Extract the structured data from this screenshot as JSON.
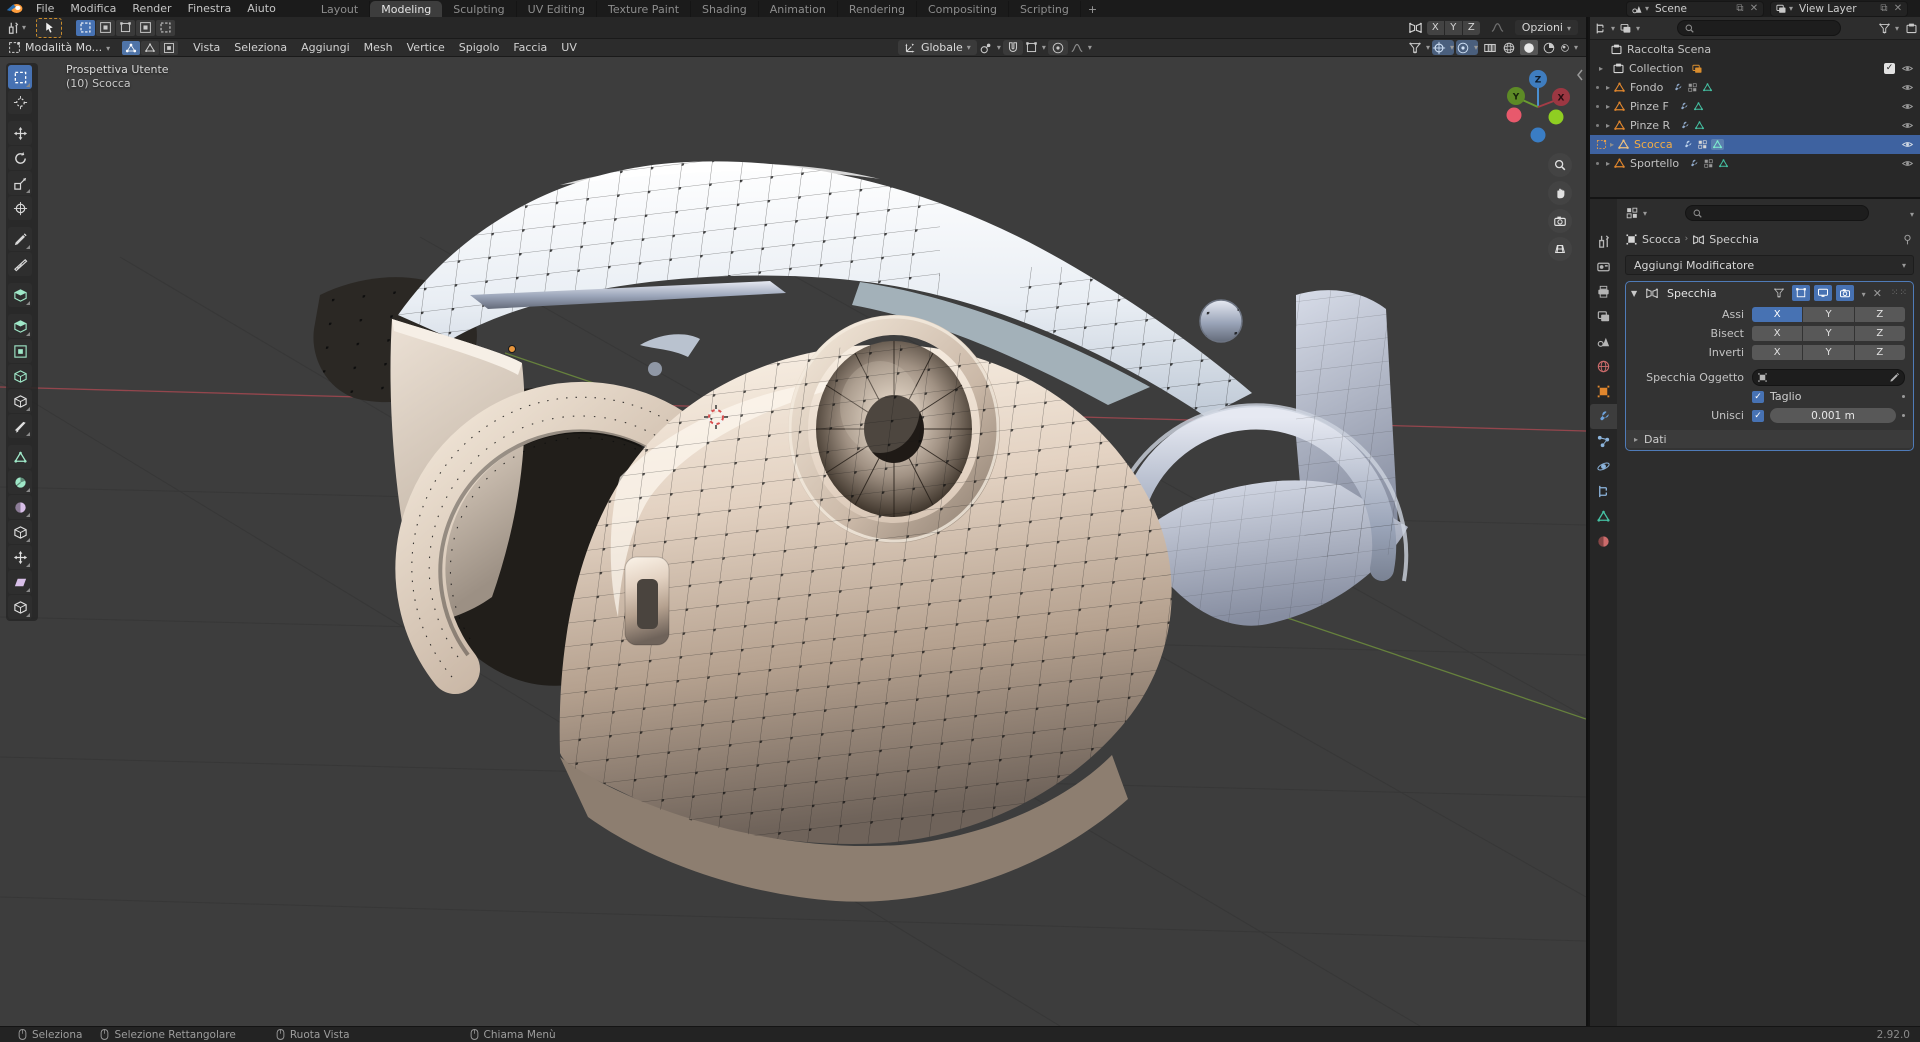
{
  "topbar": {
    "menus": [
      "File",
      "Modifica",
      "Render",
      "Finestra",
      "Aiuto"
    ],
    "workspaces": [
      "Layout",
      "Modeling",
      "Sculpting",
      "UV Editing",
      "Texture Paint",
      "Shading",
      "Animation",
      "Rendering",
      "Compositing",
      "Scripting"
    ],
    "active_workspace": "Modeling",
    "new_workspace_label": "+",
    "scene_value": "Scene",
    "view_layer_value": "View Layer"
  },
  "tool_settings": {
    "mirror_axes": [
      "X",
      "Y",
      "Z"
    ],
    "options_label": "Opzioni"
  },
  "viewport_header": {
    "mode_label": "Modalità Mo...",
    "menus": [
      "Vista",
      "Seleziona",
      "Aggiungi",
      "Mesh",
      "Vertice",
      "Spigolo",
      "Faccia",
      "UV"
    ],
    "orientation_label": "Globale"
  },
  "viewport": {
    "view_label": "Prospettiva Utente",
    "object_label": "(10) Scocca",
    "gizmo": {
      "x": "X",
      "y": "Y",
      "z": "Z"
    },
    "tools": [
      "select-box",
      "cursor",
      "move",
      "rotate",
      "scale",
      "transform",
      "annotate",
      "measure",
      "add-cube",
      "extrude-region",
      "inset-faces",
      "bevel",
      "loop-cut",
      "knife",
      "poly-build",
      "spin",
      "smooth",
      "edge-slide",
      "shrink-fatten",
      "shear",
      "rip-region"
    ]
  },
  "outliner": {
    "rows": [
      {
        "label": "Raccolta Scena"
      },
      {
        "label": "Collection"
      },
      {
        "label": "Fondo"
      },
      {
        "label": "Pinze F"
      },
      {
        "label": "Pinze R"
      },
      {
        "label": "Scocca"
      },
      {
        "label": "Sportello"
      }
    ]
  },
  "properties": {
    "tabs": [
      "tool",
      "render",
      "output",
      "view-layer",
      "scene",
      "world",
      "object",
      "modifiers",
      "particles",
      "physics",
      "constraints",
      "data",
      "material"
    ],
    "active_tab": "modifiers",
    "breadcrumb": {
      "object": "Scocca",
      "modifier": "Specchia"
    },
    "add_modifier_label": "Aggiungi Modificatore",
    "modifier": {
      "name": "Specchia",
      "axis_label": "Assi",
      "bisect_label": "Bisect",
      "flip_label": "Inverti",
      "axes": [
        "X",
        "Y",
        "Z"
      ],
      "axis_active": "X",
      "mirror_object_label": "Specchia Oggetto",
      "clipping_label": "Taglio",
      "merge_label": "Unisci",
      "merge_value": "0.001 m",
      "data_label": "Dati"
    }
  },
  "statusbar": {
    "hints": [
      {
        "label": "Seleziona",
        "button": "left"
      },
      {
        "label": "Selezione Rettangolare",
        "button": "left-drag"
      },
      {
        "label": "Ruota Vista",
        "button": "middle"
      },
      {
        "label": "Chiama Menù",
        "button": "right"
      }
    ],
    "version": "2.92.0"
  },
  "colors": {
    "accent_blue": "#4772b3",
    "selection_blue": "#3e62a0",
    "active_object_orange": "#f5ad43",
    "axis_x": "#b6465f",
    "axis_y": "#6a9b30",
    "axis_z": "#3f78c1",
    "mesh_data_green": "#45c0a2",
    "object_orange": "#e0862d",
    "viewport_bg": "#3d3d3d"
  }
}
